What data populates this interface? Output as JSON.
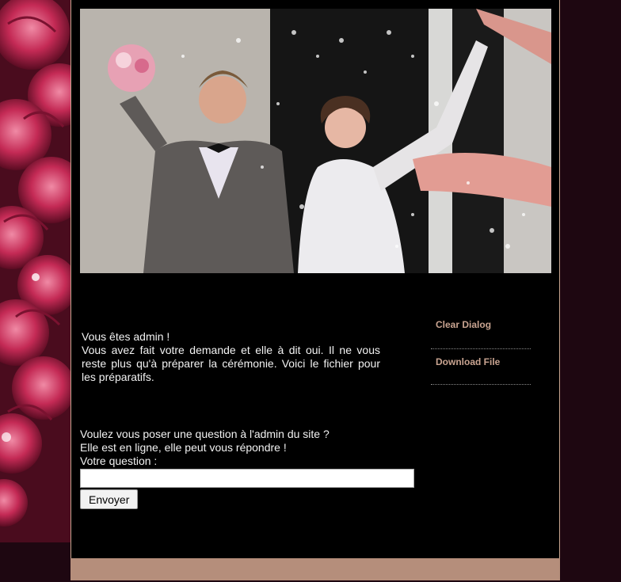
{
  "hero": {
    "image_description_icon": "wedding-couple-photo"
  },
  "main": {
    "admin_line": "Vous êtes admin !",
    "message": "Vous avez fait votre demande et elle à dit oui. Il ne vous reste plus qu'à préparer la cérémonie. Voici le fichier pour les préparatifs."
  },
  "question": {
    "line1": "Voulez vous poser une question à l'admin du site ?",
    "line2": "Elle est en ligne, elle peut vous répondre !",
    "label": "Votre question :",
    "input_value": "",
    "button_label": "Envoyer"
  },
  "sidebar": {
    "items": [
      {
        "label": "Clear Dialog"
      },
      {
        "label": "Download File"
      }
    ]
  },
  "colors": {
    "background": "#1e0711",
    "page": "#000000",
    "link": "#c9a491",
    "footer": "#b58e7b"
  }
}
